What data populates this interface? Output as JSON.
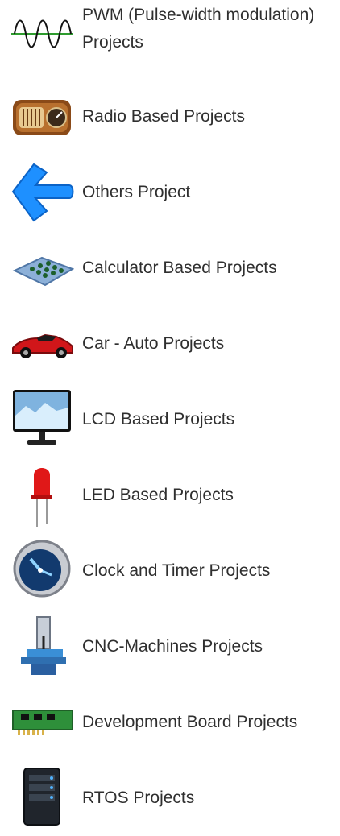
{
  "items": [
    {
      "label": "PWM (Pulse-width modulation) Projects",
      "icon": "sine-wave-icon"
    },
    {
      "label": "Radio Based Projects",
      "icon": "radio-icon"
    },
    {
      "label": "Others Project",
      "icon": "blue-arrow-icon"
    },
    {
      "label": "Calculator Based Projects",
      "icon": "calculator-keypad-icon"
    },
    {
      "label": "Car - Auto Projects",
      "icon": "red-car-icon"
    },
    {
      "label": "LCD Based Projects",
      "icon": "lcd-monitor-icon"
    },
    {
      "label": "LED Based Projects",
      "icon": "red-led-icon"
    },
    {
      "label": "Clock and Timer Projects",
      "icon": "clock-icon"
    },
    {
      "label": "CNC-Machines Projects",
      "icon": "cnc-machine-icon"
    },
    {
      "label": "Development Board Projects",
      "icon": "circuit-board-icon"
    },
    {
      "label": "RTOS Projects",
      "icon": "server-tower-icon"
    }
  ]
}
